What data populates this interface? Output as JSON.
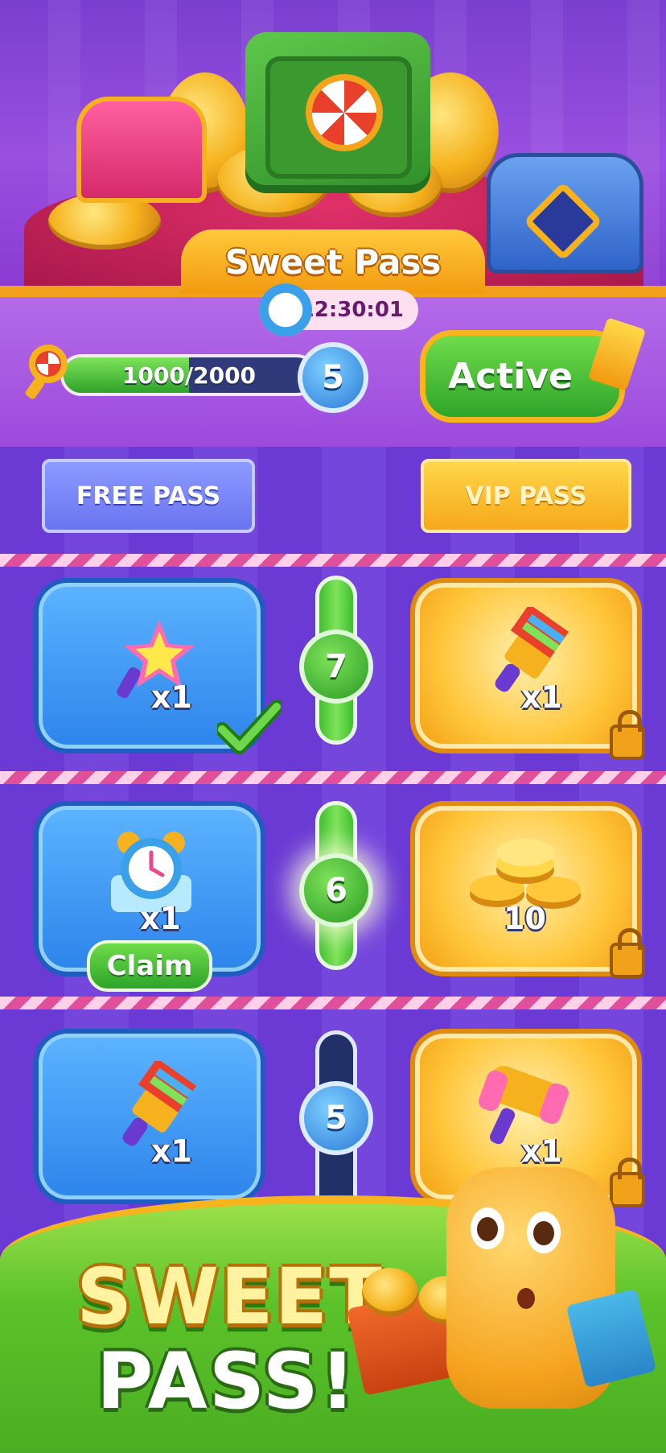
{
  "header": {
    "title": "Sweet Pass",
    "timer": "12:30:01"
  },
  "progress": {
    "value_text": "1000/2000",
    "current": 1000,
    "max": 2000,
    "level": "5",
    "status_button": "Active"
  },
  "passes": {
    "free_label": "FREE PASS",
    "vip_label": "VIP PASS"
  },
  "tiers": [
    {
      "level": "7",
      "reached": true,
      "free": {
        "item": "star-wand-icon",
        "qty": "x1",
        "claimed": true
      },
      "vip": {
        "item": "paint-brush-icon",
        "qty": "x1",
        "locked": true
      }
    },
    {
      "level": "6",
      "reached": true,
      "free": {
        "item": "alarm-clock-icon",
        "qty": "x1",
        "action": "Claim"
      },
      "vip": {
        "item": "gold-coins-icon",
        "qty": "10",
        "locked": true
      }
    },
    {
      "level": "5",
      "reached": false,
      "free": {
        "item": "paint-brush-icon",
        "qty": "x1"
      },
      "vip": {
        "item": "hammer-icon",
        "qty": "x1",
        "locked": true
      }
    }
  ],
  "promo": {
    "line1": "SWEET",
    "line2": "PASS!"
  },
  "colors": {
    "accent_green": "#2ea42a",
    "accent_gold": "#f6b51e",
    "bg_purple": "#6b3ad4"
  }
}
